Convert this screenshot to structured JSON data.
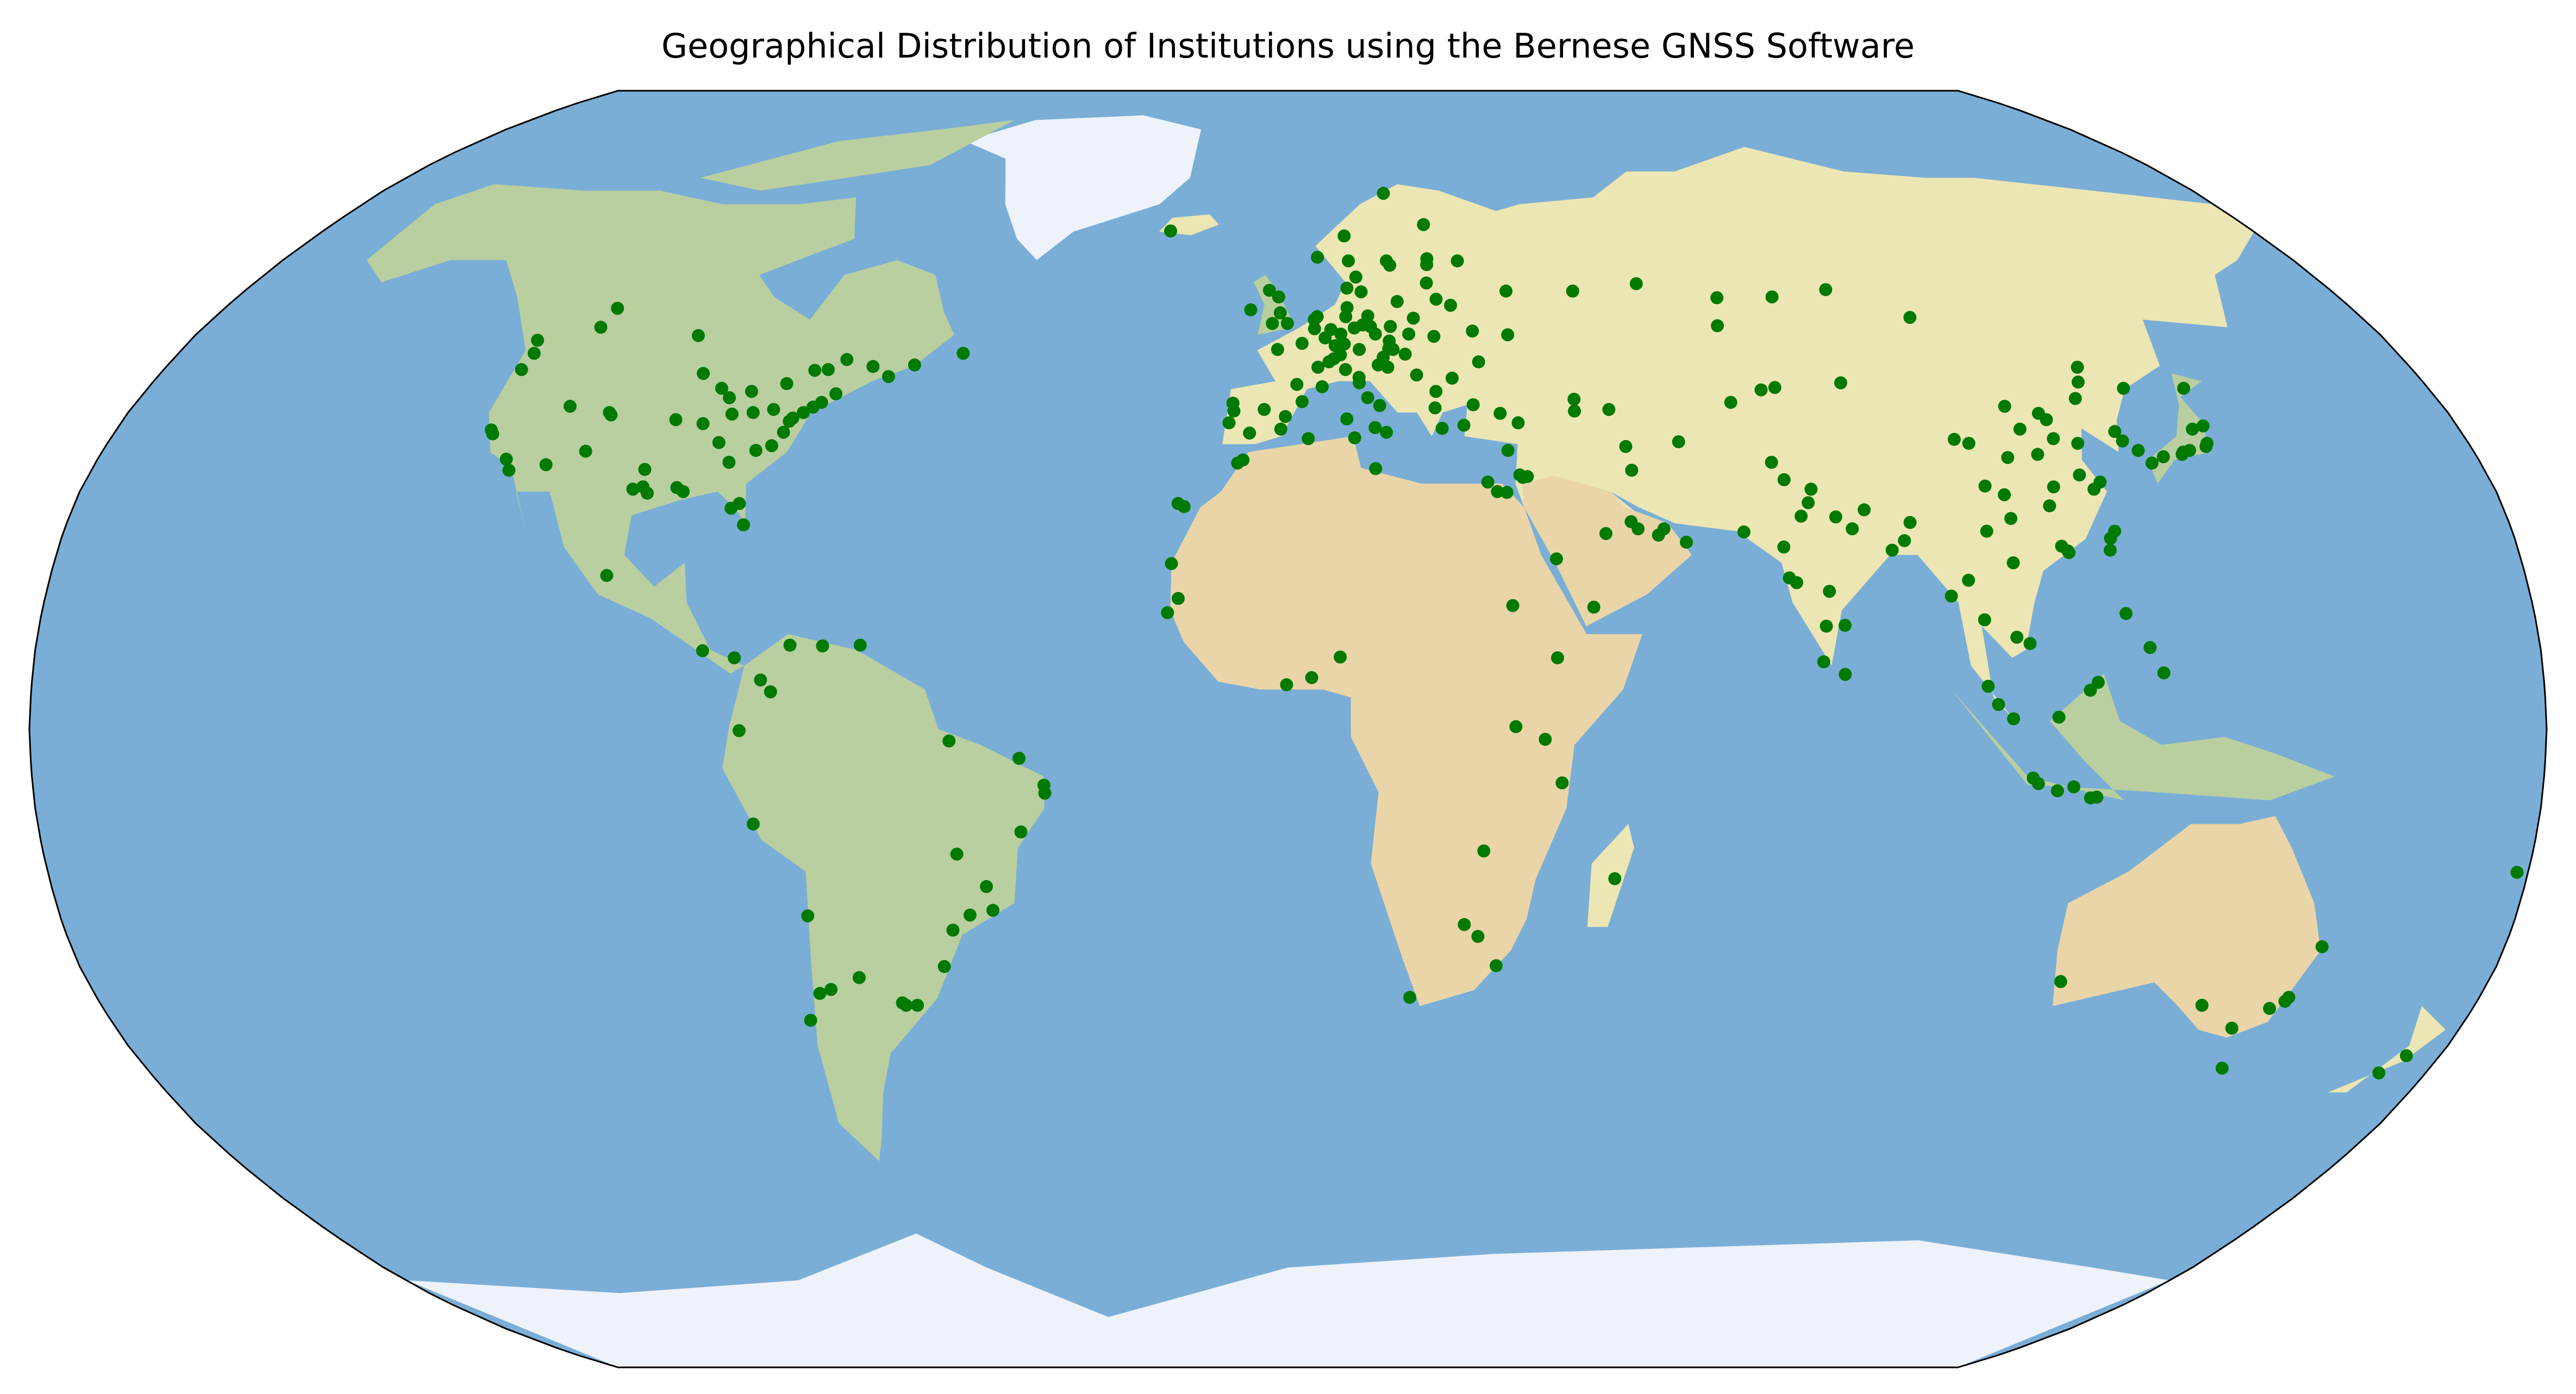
{
  "map": {
    "title": "Geographical Distribution of Institutions using the Bernese GNSS Software",
    "projection": "robinson",
    "basemap": "natural-earth-relief",
    "marker": {
      "shape": "circle",
      "color": "#007a00"
    },
    "colors": {
      "ocean": "#7aaed6",
      "land": "#ece6b4",
      "forest": "#b9cfa0",
      "desert": "#ead5a8",
      "ice": "#eef2fa",
      "mountain": "#cfd3d6",
      "border": "#000000"
    },
    "institutions": [
      {
        "lon": -122.3,
        "lat": 47.6
      },
      {
        "lon": -123.1,
        "lat": 49.3
      },
      {
        "lon": -122.7,
        "lat": 45.5
      },
      {
        "lon": -122.4,
        "lat": 37.8
      },
      {
        "lon": -121.9,
        "lat": 37.3
      },
      {
        "lon": -118.2,
        "lat": 34.1
      },
      {
        "lon": -117.2,
        "lat": 32.7
      },
      {
        "lon": -113.5,
        "lat": 53.5
      },
      {
        "lon": -114.1,
        "lat": 51.0
      },
      {
        "lon": -111.9,
        "lat": 40.8
      },
      {
        "lon": -105.3,
        "lat": 40.0
      },
      {
        "lon": -104.9,
        "lat": 39.7
      },
      {
        "lon": -97.1,
        "lat": 49.9
      },
      {
        "lon": -106.6,
        "lat": 35.1
      },
      {
        "lon": -111.9,
        "lat": 33.4
      },
      {
        "lon": -97.7,
        "lat": 30.3
      },
      {
        "lon": -96.8,
        "lat": 32.8
      },
      {
        "lon": -95.4,
        "lat": 29.8
      },
      {
        "lon": -96.3,
        "lat": 30.6
      },
      {
        "lon": -90.1,
        "lat": 30.0
      },
      {
        "lon": -91.2,
        "lat": 30.5
      },
      {
        "lon": -93.3,
        "lat": 45.0
      },
      {
        "lon": -87.6,
        "lat": 41.9
      },
      {
        "lon": -89.4,
        "lat": 43.1
      },
      {
        "lon": -86.2,
        "lat": 39.8
      },
      {
        "lon": -90.2,
        "lat": 38.6
      },
      {
        "lon": -94.6,
        "lat": 39.1
      },
      {
        "lon": -86.8,
        "lat": 36.2
      },
      {
        "lon": -84.4,
        "lat": 33.7
      },
      {
        "lon": -82.5,
        "lat": 27.9
      },
      {
        "lon": -80.2,
        "lat": 25.8
      },
      {
        "lon": -81.4,
        "lat": 28.5
      },
      {
        "lon": -83.0,
        "lat": 40.0
      },
      {
        "lon": -84.5,
        "lat": 42.7
      },
      {
        "lon": -80.0,
        "lat": 40.4
      },
      {
        "lon": -79.4,
        "lat": 43.7
      },
      {
        "lon": -75.7,
        "lat": 45.4
      },
      {
        "lon": -73.6,
        "lat": 45.5
      },
      {
        "lon": -71.2,
        "lat": 46.8
      },
      {
        "lon": -77.0,
        "lat": 38.9
      },
      {
        "lon": -76.6,
        "lat": 39.3
      },
      {
        "lon": -75.2,
        "lat": 40.0
      },
      {
        "lon": -74.0,
        "lat": 40.7
      },
      {
        "lon": -71.1,
        "lat": 42.4
      },
      {
        "lon": -72.9,
        "lat": 41.3
      },
      {
        "lon": -78.6,
        "lat": 35.8
      },
      {
        "lon": -80.8,
        "lat": 35.2
      },
      {
        "lon": -77.4,
        "lat": 37.5
      },
      {
        "lon": -63.6,
        "lat": 44.6
      },
      {
        "lon": -66.6,
        "lat": 45.9
      },
      {
        "lon": -52.7,
        "lat": 47.6
      },
      {
        "lon": -60.0,
        "lat": 46.1
      },
      {
        "lon": -99.1,
        "lat": 19.4
      },
      {
        "lon": -79.5,
        "lat": 9.0
      },
      {
        "lon": -84.1,
        "lat": 9.9
      },
      {
        "lon": -74.1,
        "lat": 4.7
      },
      {
        "lon": -75.6,
        "lat": 6.2
      },
      {
        "lon": -66.9,
        "lat": 10.5
      },
      {
        "lon": -71.6,
        "lat": 10.6
      },
      {
        "lon": -61.5,
        "lat": 10.6
      },
      {
        "lon": -78.5,
        "lat": -0.2
      },
      {
        "lon": -77.0,
        "lat": -12.0
      },
      {
        "lon": -47.9,
        "lat": -15.8
      },
      {
        "lon": -43.2,
        "lat": -22.9
      },
      {
        "lon": -46.6,
        "lat": -23.5
      },
      {
        "lon": -49.3,
        "lat": -25.4
      },
      {
        "lon": -51.2,
        "lat": -30.0
      },
      {
        "lon": -48.5,
        "lat": -1.5
      },
      {
        "lon": -38.5,
        "lat": -3.7
      },
      {
        "lon": -34.9,
        "lat": -8.1
      },
      {
        "lon": -35.0,
        "lat": -7.1
      },
      {
        "lon": -38.5,
        "lat": -13.0
      },
      {
        "lon": -43.9,
        "lat": -19.9
      },
      {
        "lon": -58.4,
        "lat": -34.6
      },
      {
        "lon": -57.9,
        "lat": -34.9
      },
      {
        "lon": -56.2,
        "lat": -34.9
      },
      {
        "lon": -64.2,
        "lat": -31.4
      },
      {
        "lon": -68.8,
        "lat": -32.9
      },
      {
        "lon": -70.6,
        "lat": -33.4
      },
      {
        "lon": -70.4,
        "lat": -23.6
      },
      {
        "lon": -73.0,
        "lat": -36.8
      },
      {
        "lon": -21.9,
        "lat": 64.1
      },
      {
        "lon": -9.1,
        "lat": 38.7
      },
      {
        "lon": -8.4,
        "lat": 40.2
      },
      {
        "lon": -8.6,
        "lat": 41.2
      },
      {
        "lon": -3.7,
        "lat": 40.4
      },
      {
        "lon": -5.9,
        "lat": 37.4
      },
      {
        "lon": 2.2,
        "lat": 41.4
      },
      {
        "lon": -0.4,
        "lat": 39.5
      },
      {
        "lon": -1.1,
        "lat": 37.9
      },
      {
        "lon": -15.4,
        "lat": 28.1
      },
      {
        "lon": -16.3,
        "lat": 28.5
      },
      {
        "lon": -17.4,
        "lat": 14.7
      },
      {
        "lon": -7.6,
        "lat": 33.6
      },
      {
        "lon": -6.8,
        "lat": 34.0
      },
      {
        "lon": 3.1,
        "lat": 36.7
      },
      {
        "lon": 10.2,
        "lat": 36.8
      },
      {
        "lon": 13.2,
        "lat": 32.9
      },
      {
        "lon": 31.2,
        "lat": 30.0
      },
      {
        "lon": 29.9,
        "lat": 31.2
      },
      {
        "lon": 32.6,
        "lat": 29.9
      },
      {
        "lon": -0.1,
        "lat": 51.5
      },
      {
        "lon": -1.3,
        "lat": 52.9
      },
      {
        "lon": -1.6,
        "lat": 55.0
      },
      {
        "lon": -3.2,
        "lat": 55.9
      },
      {
        "lon": -6.3,
        "lat": 53.3
      },
      {
        "lon": -2.6,
        "lat": 51.5
      },
      {
        "lon": 2.3,
        "lat": 48.9
      },
      {
        "lon": 4.8,
        "lat": 45.8
      },
      {
        "lon": 1.4,
        "lat": 43.6
      },
      {
        "lon": 5.4,
        "lat": 43.3
      },
      {
        "lon": -1.7,
        "lat": 48.1
      },
      {
        "lon": 7.7,
        "lat": 48.6
      },
      {
        "lon": 4.4,
        "lat": 50.8
      },
      {
        "lon": 4.9,
        "lat": 52.4
      },
      {
        "lon": 4.4,
        "lat": 52.0
      },
      {
        "lon": 6.1,
        "lat": 49.6
      },
      {
        "lon": 7.4,
        "lat": 46.9
      },
      {
        "lon": 8.5,
        "lat": 47.4
      },
      {
        "lon": 6.6,
        "lat": 46.5
      },
      {
        "lon": 9.2,
        "lat": 45.5
      },
      {
        "lon": 12.5,
        "lat": 41.9
      },
      {
        "lon": 11.3,
        "lat": 43.8
      },
      {
        "lon": 14.3,
        "lat": 40.9
      },
      {
        "lon": 15.1,
        "lat": 37.5
      },
      {
        "lon": 13.4,
        "lat": 38.1
      },
      {
        "lon": 9.1,
        "lat": 39.2
      },
      {
        "lon": 11.3,
        "lat": 44.5
      },
      {
        "lon": 13.4,
        "lat": 52.5
      },
      {
        "lon": 11.6,
        "lat": 48.1
      },
      {
        "lon": 8.7,
        "lat": 50.1
      },
      {
        "lon": 10.0,
        "lat": 53.6
      },
      {
        "lon": 7.1,
        "lat": 50.7
      },
      {
        "lon": 9.2,
        "lat": 48.8
      },
      {
        "lon": 13.7,
        "lat": 51.1
      },
      {
        "lon": 11.0,
        "lat": 50.9
      },
      {
        "lon": 9.7,
        "lat": 52.4
      },
      {
        "lon": 12.4,
        "lat": 51.3
      },
      {
        "lon": 16.4,
        "lat": 48.2
      },
      {
        "lon": 15.4,
        "lat": 47.1
      },
      {
        "lon": 14.4,
        "lat": 50.1
      },
      {
        "lon": 16.6,
        "lat": 49.2
      },
      {
        "lon": 17.1,
        "lat": 48.1
      },
      {
        "lon": 19.0,
        "lat": 47.5
      },
      {
        "lon": 21.0,
        "lat": 52.2
      },
      {
        "lon": 19.9,
        "lat": 50.1
      },
      {
        "lon": 17.0,
        "lat": 51.1
      },
      {
        "lon": 18.6,
        "lat": 54.4
      },
      {
        "lon": 14.5,
        "lat": 46.1
      },
      {
        "lon": 16.0,
        "lat": 45.8
      },
      {
        "lon": 20.5,
        "lat": 44.8
      },
      {
        "lon": 26.1,
        "lat": 44.4
      },
      {
        "lon": 23.3,
        "lat": 42.7
      },
      {
        "lon": 23.7,
        "lat": 38.0
      },
      {
        "lon": 22.9,
        "lat": 40.6
      },
      {
        "lon": 28.9,
        "lat": 41.0
      },
      {
        "lon": 32.9,
        "lat": 39.9
      },
      {
        "lon": 27.1,
        "lat": 38.4
      },
      {
        "lon": 35.5,
        "lat": 38.7
      },
      {
        "lon": 33.4,
        "lat": 35.2
      },
      {
        "lon": 35.2,
        "lat": 31.8
      },
      {
        "lon": 34.8,
        "lat": 32.1
      },
      {
        "lon": 35.9,
        "lat": 31.9
      },
      {
        "lon": 12.6,
        "lat": 55.7
      },
      {
        "lon": 10.2,
        "lat": 56.2
      },
      {
        "lon": 10.8,
        "lat": 59.9
      },
      {
        "lon": 5.3,
        "lat": 60.4
      },
      {
        "lon": 10.4,
        "lat": 63.4
      },
      {
        "lon": 18.1,
        "lat": 59.3
      },
      {
        "lon": 11.9,
        "lat": 57.7
      },
      {
        "lon": 17.6,
        "lat": 59.9
      },
      {
        "lon": 24.9,
        "lat": 60.2
      },
      {
        "lon": 25.5,
        "lat": 65.0
      },
      {
        "lon": 18.9,
        "lat": 69.6
      },
      {
        "lon": 24.1,
        "lat": 56.9
      },
      {
        "lon": 25.3,
        "lat": 54.7
      },
      {
        "lon": 24.7,
        "lat": 59.4
      },
      {
        "lon": 27.6,
        "lat": 53.9
      },
      {
        "lon": 30.5,
        "lat": 50.5
      },
      {
        "lon": 36.2,
        "lat": 50.0
      },
      {
        "lon": 30.7,
        "lat": 46.5
      },
      {
        "lon": 24.0,
        "lat": 49.8
      },
      {
        "lon": 37.6,
        "lat": 55.8
      },
      {
        "lon": 30.3,
        "lat": 59.9
      },
      {
        "lon": 49.1,
        "lat": 55.8
      },
      {
        "lon": 60.6,
        "lat": 56.8
      },
      {
        "lon": 82.9,
        "lat": 55.0
      },
      {
        "lon": 104.3,
        "lat": 52.3
      },
      {
        "lon": 92.9,
        "lat": 56.0
      },
      {
        "lon": 73.4,
        "lat": 54.9
      },
      {
        "lon": 44.8,
        "lat": 41.7
      },
      {
        "lon": 44.5,
        "lat": 40.2
      },
      {
        "lon": 49.9,
        "lat": 40.4
      },
      {
        "lon": 51.4,
        "lat": 35.7
      },
      {
        "lon": 51.7,
        "lat": 32.7
      },
      {
        "lon": 59.6,
        "lat": 36.3
      },
      {
        "lon": 46.7,
        "lat": 24.7
      },
      {
        "lon": 39.2,
        "lat": 21.5
      },
      {
        "lon": 50.6,
        "lat": 26.2
      },
      {
        "lon": 51.5,
        "lat": 25.3
      },
      {
        "lon": 54.4,
        "lat": 24.5
      },
      {
        "lon": 55.3,
        "lat": 25.3
      },
      {
        "lon": 58.4,
        "lat": 23.6
      },
      {
        "lon": 44.2,
        "lat": 15.4
      },
      {
        "lon": 71.4,
        "lat": 51.2
      },
      {
        "lon": 76.9,
        "lat": 43.2
      },
      {
        "lon": 69.2,
        "lat": 41.3
      },
      {
        "lon": 74.6,
        "lat": 42.9
      },
      {
        "lon": 87.6,
        "lat": 43.8
      },
      {
        "lon": 73.0,
        "lat": 33.7
      },
      {
        "lon": 74.3,
        "lat": 31.5
      },
      {
        "lon": 67.0,
        "lat": 24.9
      },
      {
        "lon": 77.2,
        "lat": 28.6
      },
      {
        "lon": 78.0,
        "lat": 30.3
      },
      {
        "lon": 75.8,
        "lat": 26.9
      },
      {
        "lon": 72.6,
        "lat": 23.0
      },
      {
        "lon": 72.9,
        "lat": 19.1
      },
      {
        "lon": 73.9,
        "lat": 18.5
      },
      {
        "lon": 78.5,
        "lat": 17.4
      },
      {
        "lon": 77.6,
        "lat": 13.0
      },
      {
        "lon": 80.3,
        "lat": 13.1
      },
      {
        "lon": 76.9,
        "lat": 8.5
      },
      {
        "lon": 79.9,
        "lat": 6.9
      },
      {
        "lon": 88.4,
        "lat": 22.6
      },
      {
        "lon": 85.3,
        "lat": 27.7
      },
      {
        "lon": 90.4,
        "lat": 23.8
      },
      {
        "lon": 91.7,
        "lat": 26.1
      },
      {
        "lon": 83.0,
        "lat": 25.3
      },
      {
        "lon": 80.9,
        "lat": 26.8
      },
      {
        "lon": 96.1,
        "lat": 16.8
      },
      {
        "lon": 100.5,
        "lat": 13.8
      },
      {
        "lon": 98.9,
        "lat": 18.8
      },
      {
        "lon": 104.9,
        "lat": 11.6
      },
      {
        "lon": 105.8,
        "lat": 21.0
      },
      {
        "lon": 106.7,
        "lat": 10.8
      },
      {
        "lon": 101.7,
        "lat": 3.1
      },
      {
        "lon": 103.8,
        "lat": 1.3
      },
      {
        "lon": 100.3,
        "lat": 5.4
      },
      {
        "lon": 106.8,
        "lat": -6.2
      },
      {
        "lon": 107.6,
        "lat": -6.9
      },
      {
        "lon": 110.4,
        "lat": -7.8
      },
      {
        "lon": 112.7,
        "lat": -7.3
      },
      {
        "lon": 115.2,
        "lat": -8.7
      },
      {
        "lon": 116.1,
        "lat": -8.6
      },
      {
        "lon": 110.3,
        "lat": 1.5
      },
      {
        "lon": 116.1,
        "lat": 5.9
      },
      {
        "lon": 114.9,
        "lat": 4.9
      },
      {
        "lon": 121.0,
        "lat": 14.6
      },
      {
        "lon": 123.9,
        "lat": 10.3
      },
      {
        "lon": 125.6,
        "lat": 7.1
      },
      {
        "lon": 114.2,
        "lat": 22.3
      },
      {
        "lon": 113.3,
        "lat": 23.1
      },
      {
        "lon": 114.1,
        "lat": 22.5
      },
      {
        "lon": 121.5,
        "lat": 25.0
      },
      {
        "lon": 120.7,
        "lat": 24.1
      },
      {
        "lon": 120.3,
        "lat": 22.6
      },
      {
        "lon": 121.5,
        "lat": 31.2
      },
      {
        "lon": 120.2,
        "lat": 30.3
      },
      {
        "lon": 118.8,
        "lat": 32.1
      },
      {
        "lon": 114.3,
        "lat": 30.6
      },
      {
        "lon": 112.9,
        "lat": 28.2
      },
      {
        "lon": 108.9,
        "lat": 34.3
      },
      {
        "lon": 104.1,
        "lat": 30.7
      },
      {
        "lon": 106.6,
        "lat": 29.6
      },
      {
        "lon": 102.7,
        "lat": 25.0
      },
      {
        "lon": 106.7,
        "lat": 26.6
      },
      {
        "lon": 103.8,
        "lat": 36.1
      },
      {
        "lon": 101.8,
        "lat": 36.6
      },
      {
        "lon": 111.7,
        "lat": 40.8
      },
      {
        "lon": 116.4,
        "lat": 39.9
      },
      {
        "lon": 117.2,
        "lat": 39.1
      },
      {
        "lon": 117.0,
        "lat": 36.7
      },
      {
        "lon": 120.4,
        "lat": 36.1
      },
      {
        "lon": 113.6,
        "lat": 34.7
      },
      {
        "lon": 112.5,
        "lat": 37.9
      },
      {
        "lon": 123.4,
        "lat": 41.8
      },
      {
        "lon": 125.3,
        "lat": 43.9
      },
      {
        "lon": 126.6,
        "lat": 45.8
      },
      {
        "lon": 126.9,
        "lat": 37.6
      },
      {
        "lon": 129.1,
        "lat": 35.2
      },
      {
        "lon": 127.4,
        "lat": 36.4
      },
      {
        "lon": 139.7,
        "lat": 35.7
      },
      {
        "lon": 140.1,
        "lat": 36.1
      },
      {
        "lon": 135.5,
        "lat": 34.7
      },
      {
        "lon": 135.8,
        "lat": 35.0
      },
      {
        "lon": 136.9,
        "lat": 35.2
      },
      {
        "lon": 130.4,
        "lat": 33.6
      },
      {
        "lon": 140.9,
        "lat": 38.3
      },
      {
        "lon": 141.4,
        "lat": 43.1
      },
      {
        "lon": 132.5,
        "lat": 34.4
      },
      {
        "lon": 139.0,
        "lat": 37.9
      },
      {
        "lon": 131.9,
        "lat": 43.1
      },
      {
        "lon": 115.9,
        "lat": -31.9
      },
      {
        "lon": 138.6,
        "lat": -34.9
      },
      {
        "lon": 145.0,
        "lat": -37.8
      },
      {
        "lon": 149.1,
        "lat": -35.3
      },
      {
        "lon": 151.2,
        "lat": -33.9
      },
      {
        "lon": 153.0,
        "lat": -27.5
      },
      {
        "lon": 147.3,
        "lat": -42.9
      },
      {
        "lon": 150.9,
        "lat": -34.4
      },
      {
        "lon": 174.8,
        "lat": -41.3
      },
      {
        "lon": 172.6,
        "lat": -43.5
      },
      {
        "lon": 178.4,
        "lat": -18.1
      },
      {
        "lon": 3.4,
        "lat": 6.5
      },
      {
        "lon": -0.2,
        "lat": 5.6
      },
      {
        "lon": 7.5,
        "lat": 9.1
      },
      {
        "lon": 36.8,
        "lat": -1.3
      },
      {
        "lon": 39.3,
        "lat": -6.8
      },
      {
        "lon": 32.6,
        "lat": 0.3
      },
      {
        "lon": 38.7,
        "lat": 9.0
      },
      {
        "lon": 28.3,
        "lat": -15.4
      },
      {
        "lon": 28.0,
        "lat": -26.2
      },
      {
        "lon": 18.4,
        "lat": -33.9
      },
      {
        "lon": 31.0,
        "lat": -29.9
      },
      {
        "lon": 25.9,
        "lat": -24.7
      },
      {
        "lon": 47.5,
        "lat": -18.9
      },
      {
        "lon": 32.5,
        "lat": 15.6
      },
      {
        "lon": -15.9,
        "lat": 16.5
      },
      {
        "lon": -17.0,
        "lat": 20.9
      }
    ]
  }
}
